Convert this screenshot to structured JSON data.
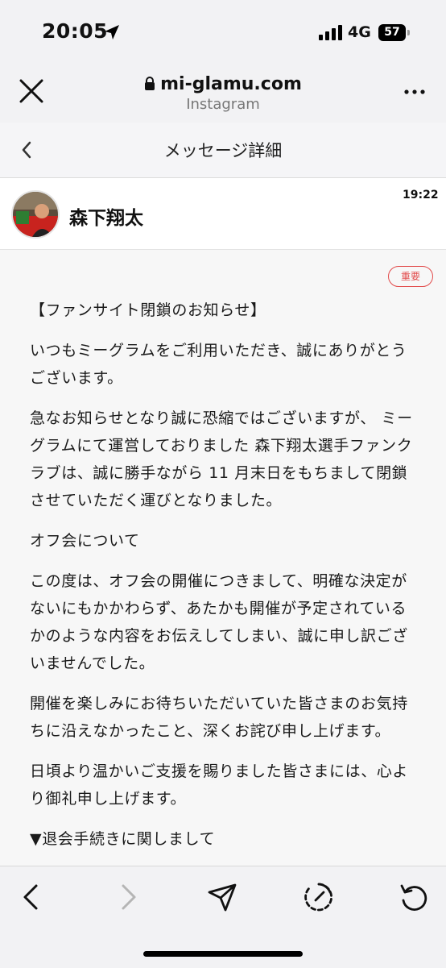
{
  "status_bar": {
    "time": "20:05",
    "network": "4G",
    "battery": "57"
  },
  "browser": {
    "url": "mi-glamu.com",
    "site_name": "Instagram"
  },
  "page": {
    "title": "メッセージ詳細"
  },
  "sender": {
    "name": "森下翔太",
    "time": "19:22"
  },
  "message": {
    "badge": "重要",
    "paragraphs": [
      "【ファンサイト閉鎖のお知らせ】",
      "いつもミーグラムをご利用いただき、誠にありがとうございます。",
      "急なお知らせとなり誠に恐縮ではございますが、 ミーグラムにて運営しておりました 森下翔太選手ファンクラブは、誠に勝手ながら 11 月末日をもちまして閉鎖させていただく運びとなりました。",
      "オフ会について",
      "この度は、オフ会の開催につきまして、明確な決定がないにもかかわらず、あたかも開催が予定されているかのような内容をお伝えしてしまい、誠に申し訳ございませんでした。",
      "開催を楽しみにお待ちいただいていた皆さまのお気持ちに沿えなかったこと、深くお詫び申し上げます。",
      "日頃より温かいご支援を賜りました皆さまには、心より御礼申し上げます。",
      "▼退会手続きに関しまして"
    ]
  },
  "icons": {
    "status": [
      "location-arrow-icon",
      "signal-icon",
      "battery-icon"
    ],
    "browser": [
      "close-icon",
      "lock-icon",
      "more-icon"
    ],
    "toolbar": [
      "back-arrow-icon",
      "forward-arrow-icon",
      "share-icon",
      "history-icon",
      "reload-icon"
    ]
  }
}
